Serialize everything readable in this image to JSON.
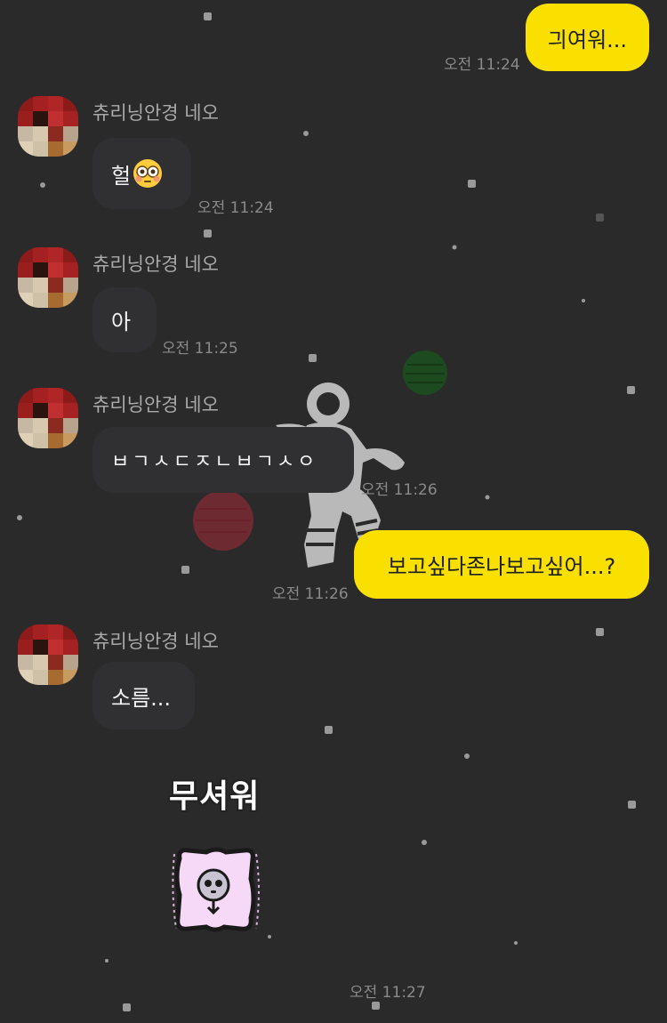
{
  "chat": {
    "messages": [
      {
        "type": "me",
        "text": "긔여워...",
        "time": "오전 11:24"
      },
      {
        "type": "other",
        "sender": "츄리닝안경 네오",
        "text": "헐",
        "emoji": "flushed-face",
        "time": "오전 11:24"
      },
      {
        "type": "other",
        "sender": "츄리닝안경 네오",
        "text": "아",
        "time": "오전 11:25"
      },
      {
        "type": "other",
        "sender": "츄리닝안경 네오",
        "text": "ㅂㄱㅅㄷㅈㄴㅂㄱㅅㅇ",
        "time": "오전 11:26"
      },
      {
        "type": "me",
        "text": "보고싶다존나보고싶어...?",
        "time": "오전 11:26"
      },
      {
        "type": "other",
        "sender": "츄리닝안경 네오",
        "text": "소름...",
        "time": "오전 11:27"
      }
    ],
    "sticker": {
      "caption": "무셔워",
      "icon": "ghost-sticker-icon"
    }
  },
  "colors": {
    "background": "#2a2a2b",
    "my_bubble": "#f9e000",
    "other_bubble": "#303032",
    "timestamp": "#8a8a8a",
    "sender_name": "#a9a9a9"
  },
  "wallpaper": {
    "theme": "space",
    "icons": [
      "astronaut-icon",
      "green-planet-icon",
      "red-planet-icon"
    ]
  }
}
